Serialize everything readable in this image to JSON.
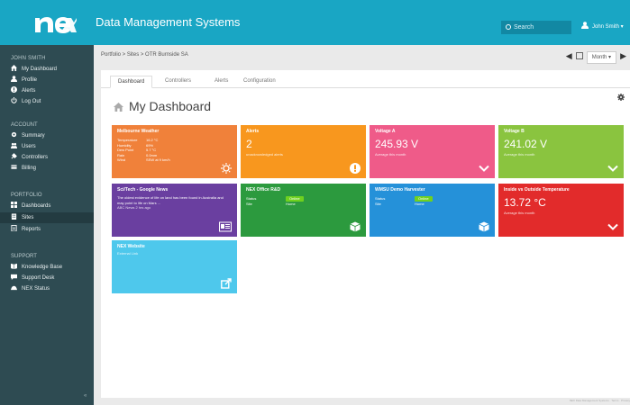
{
  "app": {
    "title": "Data Management Systems"
  },
  "search": {
    "label": "Search"
  },
  "user": {
    "name": "John Smith ▾"
  },
  "sidebar": {
    "user_label": "JOHN SMITH",
    "user_items": [
      {
        "label": "My Dashboard",
        "icon": "home-icon"
      },
      {
        "label": "Profile",
        "icon": "user-icon"
      },
      {
        "label": "Alerts",
        "icon": "alert-icon"
      },
      {
        "label": "Log Out",
        "icon": "power-icon"
      }
    ],
    "account_label": "ACCOUNT",
    "account_items": [
      {
        "label": "Summary",
        "icon": "gear-icon"
      },
      {
        "label": "Users",
        "icon": "users-icon"
      },
      {
        "label": "Controllers",
        "icon": "plug-icon"
      },
      {
        "label": "Billing",
        "icon": "bill-icon"
      }
    ],
    "portfolio_label": "PORTFOLIO",
    "portfolio_items": [
      {
        "label": "Dashboards",
        "icon": "grid-icon"
      },
      {
        "label": "Sites",
        "icon": "building-icon"
      },
      {
        "label": "Reports",
        "icon": "report-icon"
      }
    ],
    "support_label": "SUPPORT",
    "support_items": [
      {
        "label": "Knowledge Base",
        "icon": "book-icon"
      },
      {
        "label": "Support Desk",
        "icon": "chat-icon"
      },
      {
        "label": "NEX Status",
        "icon": "status-icon"
      }
    ],
    "collapse": "«"
  },
  "breadcrumb": "Portfolio  >  Sites  >  OTR Burnside SA",
  "period": {
    "selected": "Month ▾"
  },
  "tabs": [
    "Dashboard",
    "Controllers",
    "Alerts",
    "Configuration"
  ],
  "dashboard": {
    "title": "My Dashboard"
  },
  "tiles": {
    "weather": {
      "title": "Melbourne Weather",
      "rows": [
        {
          "label": "Temperature",
          "value": "16.2 °C"
        },
        {
          "label": "Humidity",
          "value": "69%"
        },
        {
          "label": "Dew Point",
          "value": "5.7 °C"
        },
        {
          "label": "Rain",
          "value": "0.0mm"
        },
        {
          "label": "Wind",
          "value": "SSW at 9 km/h"
        }
      ],
      "color": "#f0813a"
    },
    "alerts": {
      "title": "Alerts",
      "value": "2",
      "sub": "unacknowledged alerts",
      "color": "#f8971e"
    },
    "voltage_a": {
      "title": "Voltage A",
      "value": "245.93 V",
      "sub": "Average this month",
      "color": "#ef5b89"
    },
    "voltage_b": {
      "title": "Voltage B",
      "value": "241.02 V",
      "sub": "Average this month",
      "color": "#8ac43f"
    },
    "news": {
      "title": "Sci/Tech - Google News",
      "text": "The oldest evidence of life on land has been found in Australia and may point to life on Mars ...",
      "sub": "ABC News 2 hrs ago",
      "color": "#6a3fa0"
    },
    "office": {
      "title": "NEX Office R&D",
      "status_label": "Status",
      "status": "Online",
      "site_label": "Site",
      "site": "Home",
      "color": "#2c9a3e"
    },
    "harvester": {
      "title": "WMSU Demo Harvester",
      "status_label": "Status",
      "status": "Online",
      "site_label": "Site",
      "site": "Home",
      "color": "#2591d9"
    },
    "inside_outside": {
      "title": "Inside vs Outside Temperature",
      "value": "13.72 °C",
      "sub": "Average this month",
      "color": "#e22b2b"
    },
    "website": {
      "title": "NEX Website",
      "sub": "External Link",
      "color": "#4ec8ec"
    }
  },
  "footer": "NEX Data Management Systems  ·  Terms  ·  Privacy"
}
